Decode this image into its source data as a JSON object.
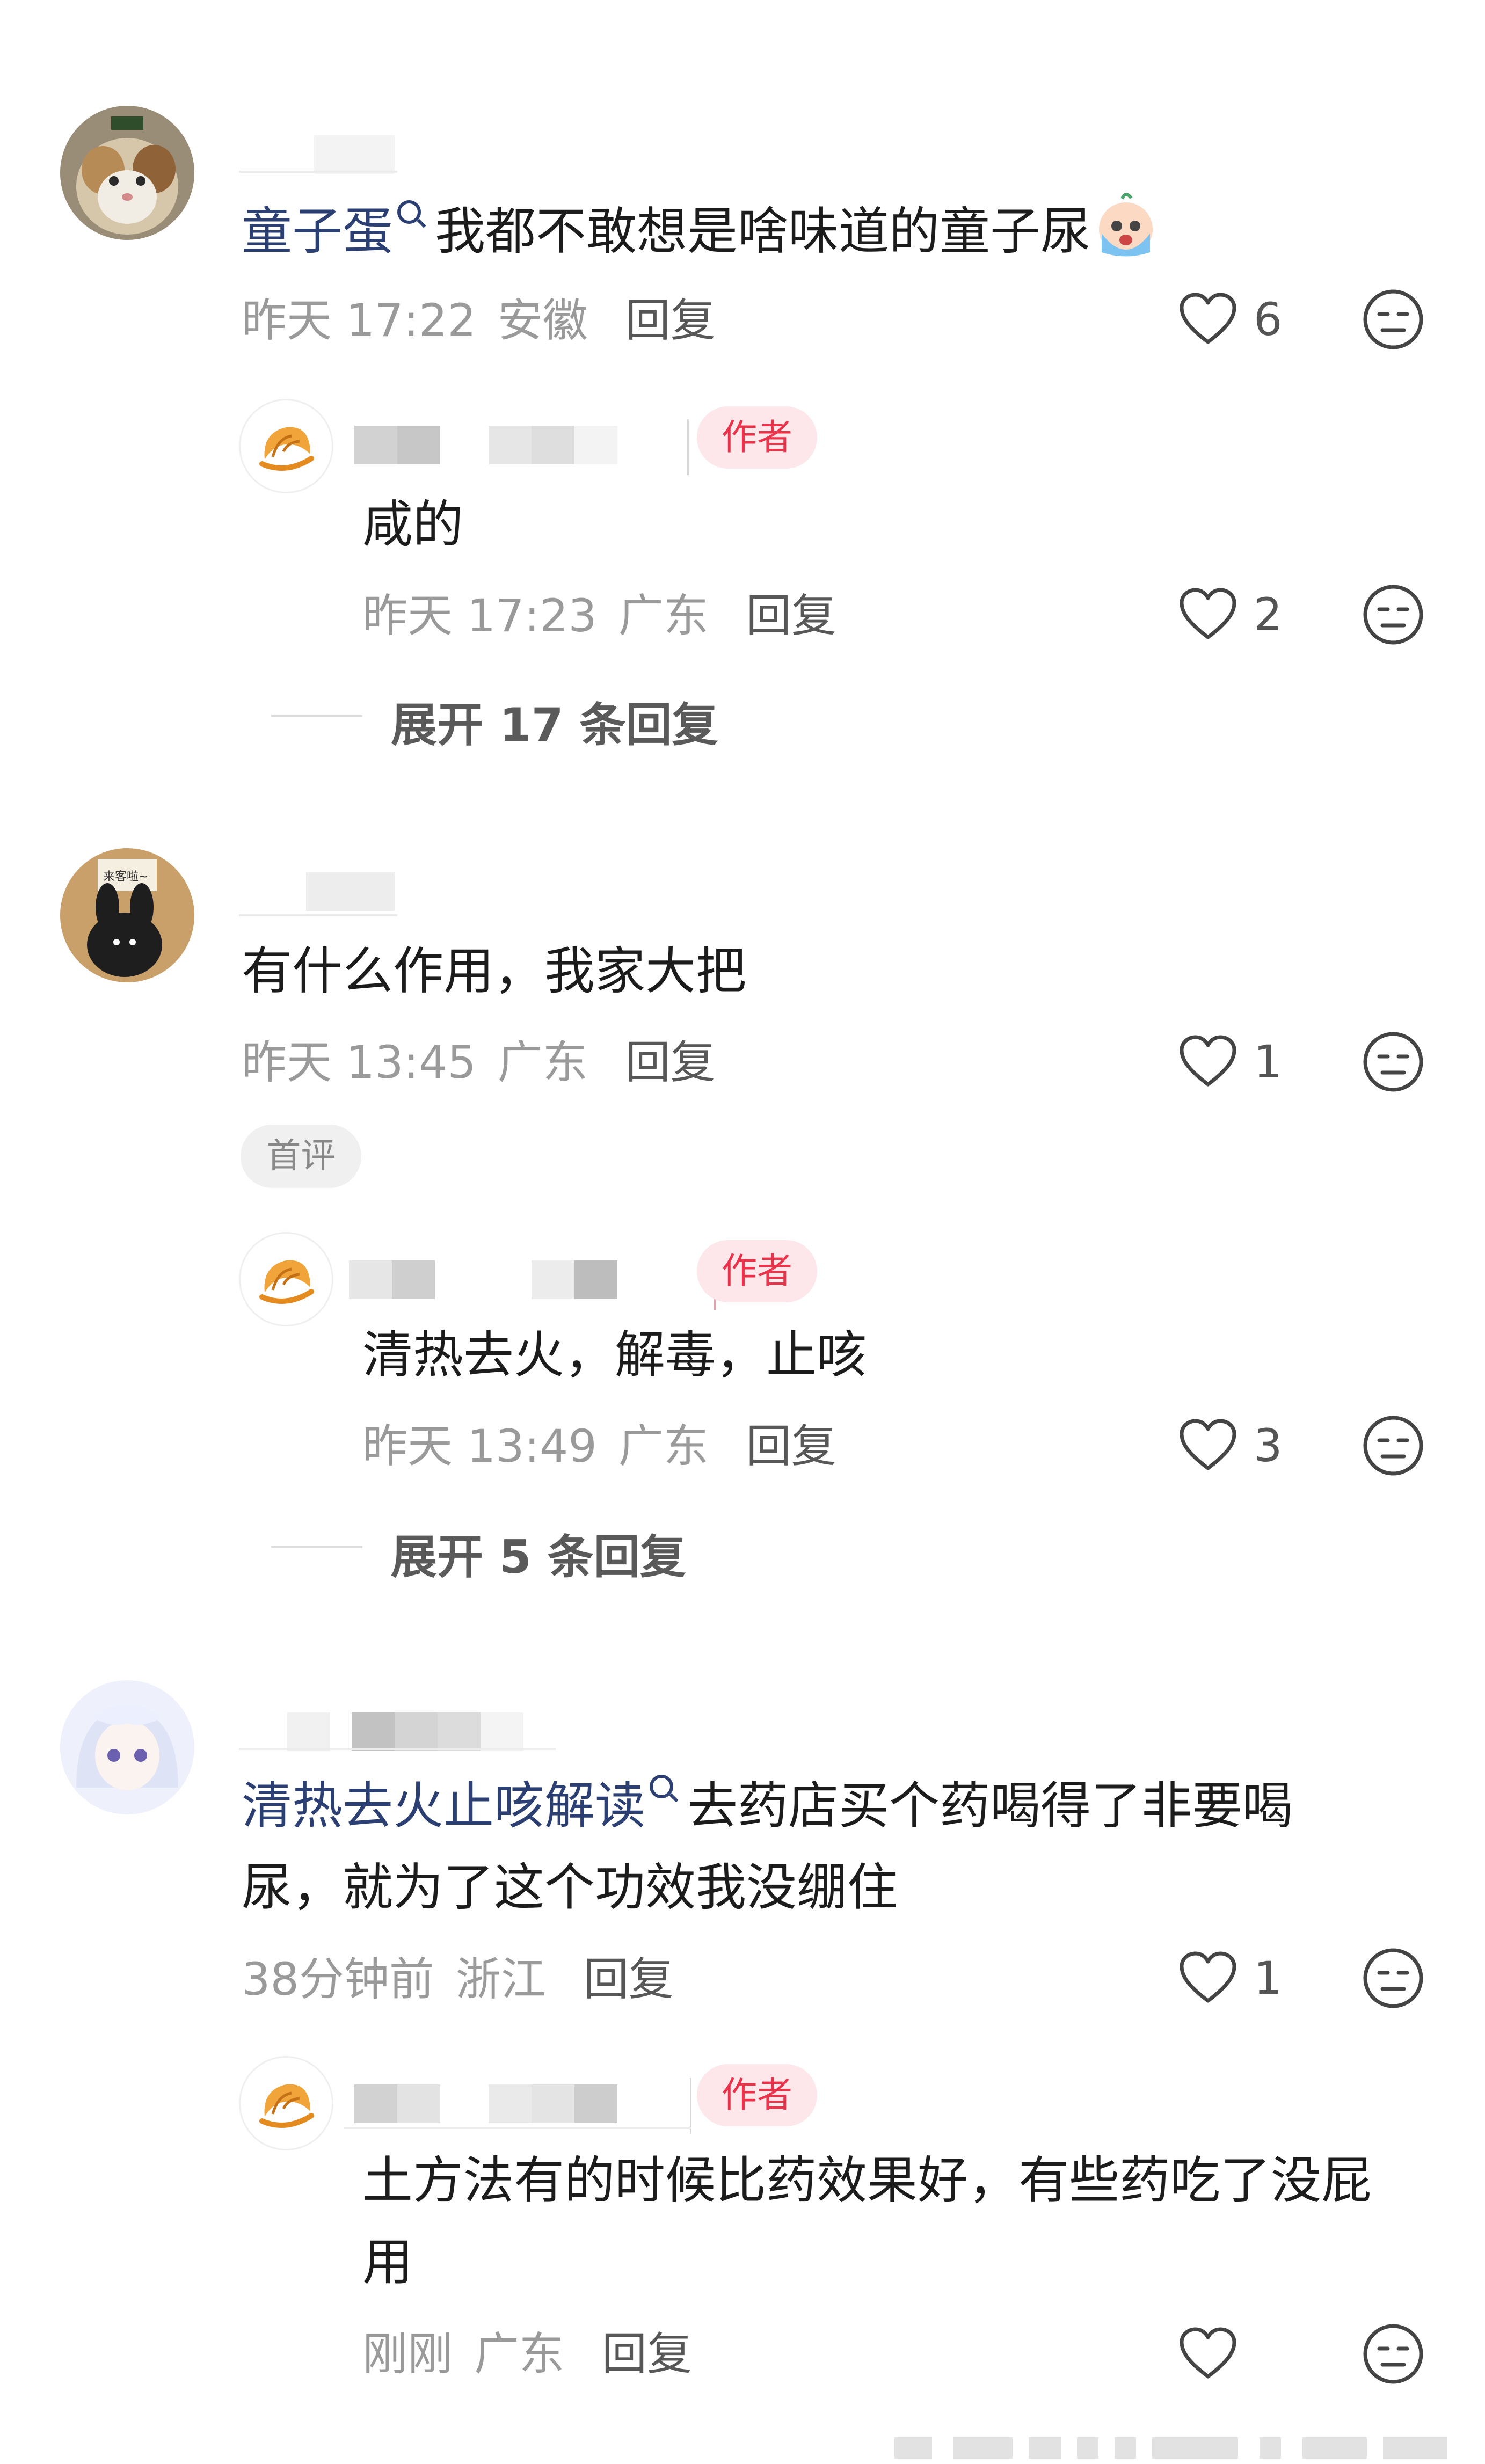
{
  "comments": [
    {
      "username": "童子蛋",
      "text": "我都不敢想是啥味道的童子尿",
      "time": "昨天 17:22",
      "location": "安徽",
      "reply_label": "回复",
      "likes": "6",
      "reply": {
        "badge": "作者",
        "text": "咸的",
        "time": "昨天 17:23",
        "location": "广东",
        "reply_label": "回复",
        "likes": "2"
      },
      "expand": "展开 17 条回复"
    },
    {
      "text": "有什么作用，我家大把",
      "time": "昨天 13:45",
      "location": "广东",
      "reply_label": "回复",
      "likes": "1",
      "first_badge": "首评",
      "reply": {
        "badge": "作者",
        "text": "清热去火，解毒，止咳",
        "time": "昨天 13:49",
        "location": "广东",
        "reply_label": "回复",
        "likes": "3"
      },
      "expand": "展开 5 条回复"
    },
    {
      "username": "清热去火止咳解读",
      "text_line1": "去药店买个药喝得了非要喝",
      "text_line2": "尿，就为了这个功效我没绷住",
      "time": "38分钟前",
      "location": "浙江",
      "reply_label": "回复",
      "likes": "1",
      "reply": {
        "badge": "作者",
        "text_line1": "土方法有的时候比药效果好，有些药吃了没屁",
        "text_line2": "用",
        "time": "刚刚",
        "location": "广东",
        "reply_label": "回复"
      }
    }
  ],
  "colors": {
    "username_link": "#2b3f73",
    "author_badge_bg": "#fde7ea",
    "author_badge_text": "#e8334b",
    "meta_text": "#9a9a9a"
  },
  "icons": {
    "like": "heart-outline-icon",
    "dislike": "neutral-face-icon",
    "reply_avatar": "croissant-icon",
    "inline_emoji": "crying-emoji-icon",
    "username_search": "search-icon"
  }
}
